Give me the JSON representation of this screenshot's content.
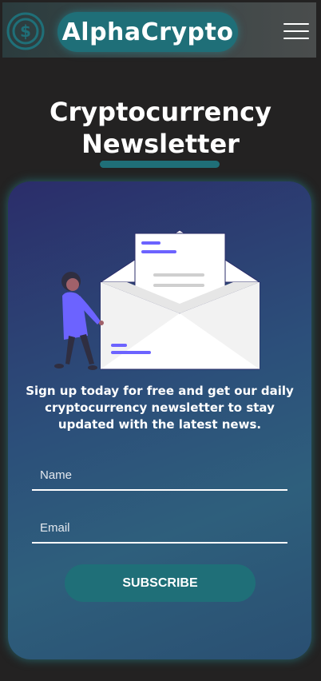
{
  "header": {
    "brand": "AlphaCrypto",
    "logo_icon": "dollar-coin-icon",
    "menu_icon": "hamburger-menu-icon"
  },
  "hero": {
    "title_line1": "Cryptocurrency",
    "title_line2": "Newsletter"
  },
  "newsletter": {
    "illustration": "person-with-envelope-illustration",
    "description": "Sign up today for free and get our daily cryptocurrency newsletter to stay updated with the latest news.",
    "name_placeholder": "Name",
    "email_placeholder": "Email",
    "subscribe_label": "SUBSCRIBE"
  },
  "colors": {
    "background": "#232222",
    "accent": "#1f6f78",
    "illustration_accent": "#6c63ff"
  }
}
